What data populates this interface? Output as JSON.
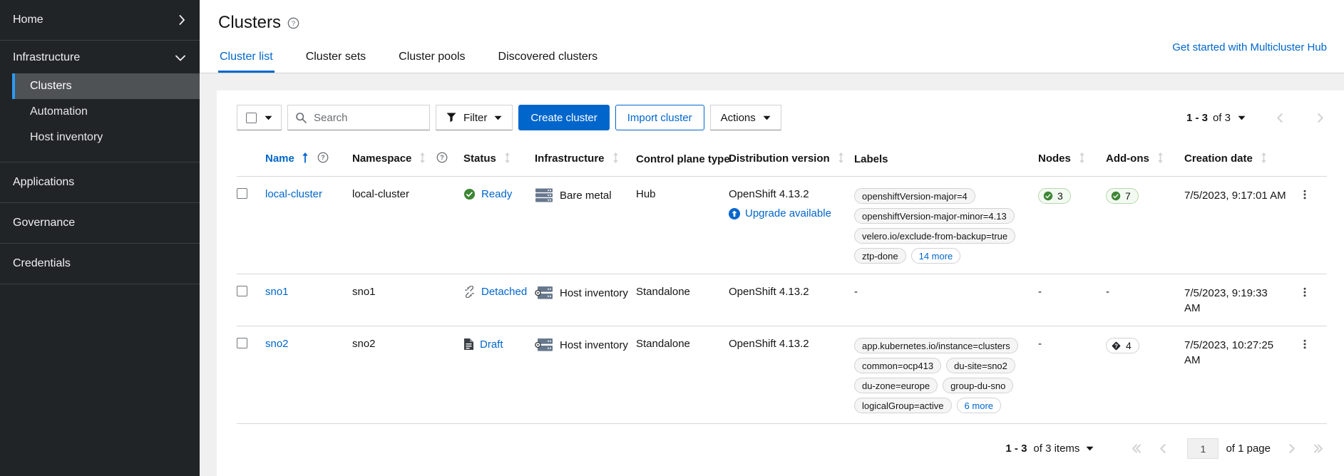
{
  "sidebar": {
    "home": "Home",
    "infrastructure": "Infrastructure",
    "sub": [
      "Clusters",
      "Automation",
      "Host inventory"
    ],
    "applications": "Applications",
    "governance": "Governance",
    "credentials": "Credentials"
  },
  "header": {
    "title": "Clusters",
    "get_started": "Get started with Multicluster Hub",
    "tabs": [
      "Cluster list",
      "Cluster sets",
      "Cluster pools",
      "Discovered clusters"
    ]
  },
  "toolbar": {
    "search_placeholder": "Search",
    "filter": "Filter",
    "create": "Create cluster",
    "import": "Import cluster",
    "actions": "Actions",
    "pagination": {
      "range": "1 - 3",
      "of": "of 3"
    }
  },
  "table": {
    "columns": [
      "Name",
      "Namespace",
      "Status",
      "Infrastructure",
      "Control plane type",
      "Distribution version",
      "Labels",
      "Nodes",
      "Add-ons",
      "Creation date"
    ],
    "rows": [
      {
        "name": "local-cluster",
        "namespace": "local-cluster",
        "status": "Ready",
        "status_icon": "check-circle-icon",
        "infrastructure": "Bare metal",
        "infra_icon": "bare-metal-icon",
        "control_plane": "Hub",
        "distribution": "OpenShift 4.13.2",
        "upgrade": "Upgrade available",
        "labels": [
          "openshiftVersion-major=4",
          "openshiftVersion-major-minor=4.13",
          "velero.io/exclude-from-backup=true",
          "ztp-done"
        ],
        "labels_more": "14 more",
        "nodes": {
          "count": "3",
          "icon": "check-circle-icon"
        },
        "addons": {
          "count": "7",
          "icon": "check-circle-icon"
        },
        "created_lines": [
          "7/5/2023, 9:17:01 AM"
        ]
      },
      {
        "name": "sno1",
        "namespace": "sno1",
        "status": "Detached",
        "status_icon": "detached-icon",
        "infrastructure": "Host inventory",
        "infra_icon": "host-inventory-icon",
        "control_plane": "Standalone",
        "distribution": "OpenShift 4.13.2",
        "labels": "-",
        "nodes": "-",
        "addons": "-",
        "created_lines": [
          "7/5/2023, 9:19:33",
          "AM"
        ]
      },
      {
        "name": "sno2",
        "namespace": "sno2",
        "status": "Draft",
        "status_icon": "draft-icon",
        "infrastructure": "Host inventory",
        "infra_icon": "host-inventory-icon",
        "control_plane": "Standalone",
        "distribution": "OpenShift 4.13.2",
        "labels": [
          "app.kubernetes.io/instance=clusters",
          "common=ocp413",
          "du-site=sno2",
          "du-zone=europe",
          "group-du-sno",
          "logicalGroup=active"
        ],
        "labels_more": "6 more",
        "nodes": "-",
        "addons": {
          "count": "4",
          "icon": "unknown-icon"
        },
        "created_lines": [
          "7/5/2023, 10:27:25",
          "AM"
        ]
      }
    ]
  },
  "pagination": {
    "range": "1 - 3",
    "of": "of 3 items",
    "page": "1",
    "of_page": "of 1 page"
  },
  "colors": {
    "primary_blue": "#0066cc",
    "ready_green": "#3e8635",
    "sidebar_bg": "#212427",
    "selected_nav": "#4f5255",
    "accent_bar": "#2b9af3",
    "page_bg": "#f0f0f0"
  }
}
